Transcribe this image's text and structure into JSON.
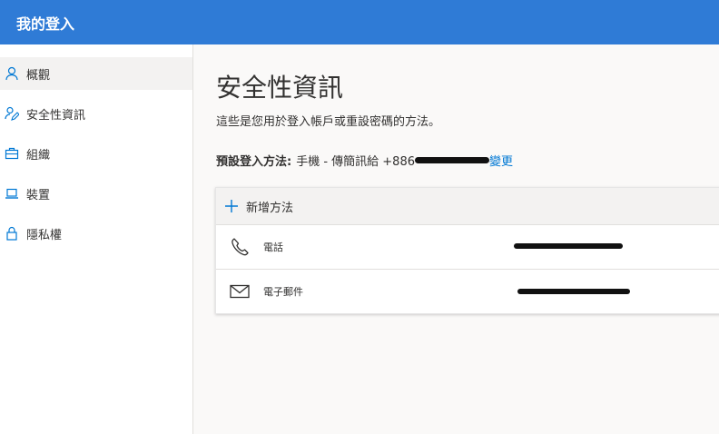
{
  "header": {
    "title": "我的登入"
  },
  "sidebar": {
    "items": [
      {
        "label": "概觀",
        "icon": "person-icon"
      },
      {
        "label": "安全性資訊",
        "icon": "person-edit-icon"
      },
      {
        "label": "組織",
        "icon": "briefcase-icon"
      },
      {
        "label": "裝置",
        "icon": "laptop-icon"
      },
      {
        "label": "隱私權",
        "icon": "lock-icon"
      }
    ]
  },
  "main": {
    "title": "安全性資訊",
    "description": "這些是您用於登入帳戶或重設密碼的方法。",
    "default_method": {
      "label": "預設登入方法:",
      "value": "手機 - 傳簡訊給 +886",
      "change_link": "變更"
    },
    "add_method_label": "新增方法",
    "methods": [
      {
        "label": "電話",
        "icon": "phone-icon"
      },
      {
        "label": "電子郵件",
        "icon": "mail-icon"
      }
    ]
  },
  "colors": {
    "header": "#2f7bd6",
    "link": "#0078d4"
  }
}
